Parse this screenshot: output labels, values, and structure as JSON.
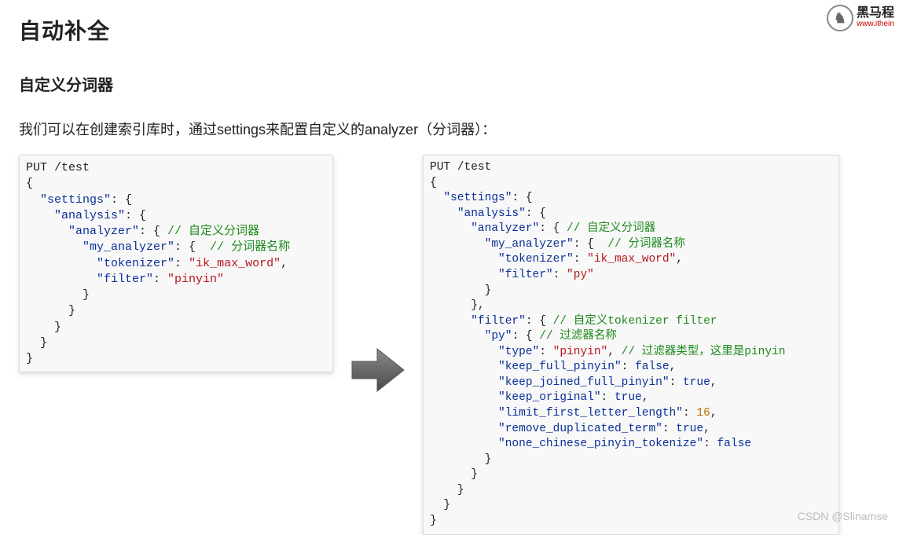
{
  "title": "自动补全",
  "subtitle": "自定义分词器",
  "lead": "我们可以在创建索引库时，通过settings来配置自定义的analyzer（分词器）：",
  "logo": {
    "big": "黑马程",
    "small": "www.ithein"
  },
  "watermark": "CSDN @Slinamse",
  "code_left": {
    "request": "PUT /test",
    "settings": "\"settings\"",
    "analysis": "\"analysis\"",
    "analyzer": "\"analyzer\"",
    "analyzer_cm": "// 自定义分词器",
    "my_analyzer": "\"my_analyzer\"",
    "my_analyzer_cm": "// 分词器名称",
    "tokenizer_k": "\"tokenizer\"",
    "tokenizer_v": "\"ik_max_word\"",
    "filter_k": "\"filter\"",
    "filter_v": "\"pinyin\""
  },
  "code_right": {
    "request": "PUT /test",
    "settings": "\"settings\"",
    "analysis": "\"analysis\"",
    "analyzer": "\"analyzer\"",
    "analyzer_cm": "// 自定义分词器",
    "my_analyzer": "\"my_analyzer\"",
    "my_analyzer_cm": "// 分词器名称",
    "tokenizer_k": "\"tokenizer\"",
    "tokenizer_v": "\"ik_max_word\"",
    "filter_k": "\"filter\"",
    "filter_v": "\"py\"",
    "filterblk": "\"filter\"",
    "filterblk_cm": "// 自定义tokenizer filter",
    "py": "\"py\"",
    "py_cm": "// 过滤器名称",
    "type_k": "\"type\"",
    "type_v": "\"pinyin\"",
    "type_cm": "// 过滤器类型，这里是pinyin",
    "kfp_k": "\"keep_full_pinyin\"",
    "kfp_v": "false",
    "kjfp_k": "\"keep_joined_full_pinyin\"",
    "kjfp_v": "true",
    "ko_k": "\"keep_original\"",
    "ko_v": "true",
    "lfl_k": "\"limit_first_letter_length\"",
    "lfl_v": "16",
    "rdt_k": "\"remove_duplicated_term\"",
    "rdt_v": "true",
    "ncpt_k": "\"none_chinese_pinyin_tokenize\"",
    "ncpt_v": "false"
  }
}
